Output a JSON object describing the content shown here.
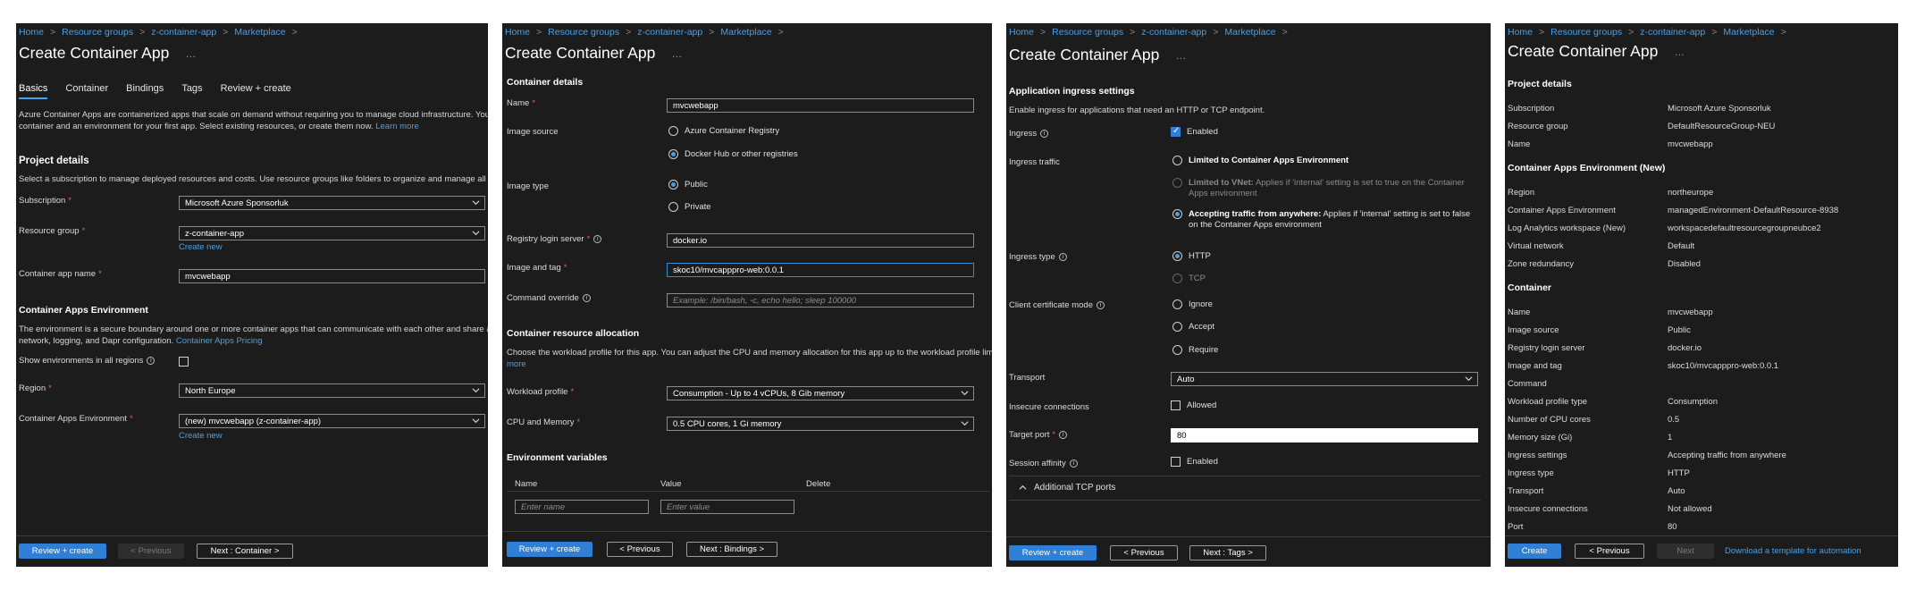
{
  "breadcrumb": [
    "Home",
    "Resource groups",
    "z-container-app",
    "Marketplace"
  ],
  "title": "Create Container App",
  "more": "…",
  "p1": {
    "tabs": [
      "Basics",
      "Container",
      "Bindings",
      "Tags",
      "Review + create"
    ],
    "intro_line1": "Azure Container Apps are containerized apps that scale on demand without requiring you to manage cloud infrastructure. You'll",
    "intro_line2": "container and an environment for your first app. Select existing resources, or create them now.",
    "learn_more": "Learn more",
    "project_details": "Project details",
    "project_desc": "Select a subscription to manage deployed resources and costs. Use resource groups like folders to organize and manage all your",
    "subscription_label": "Subscription",
    "subscription_value": "Microsoft Azure Sponsorluk",
    "rg_label": "Resource group",
    "rg_value": "z-container-app",
    "create_new": "Create new",
    "app_name_label": "Container app name",
    "app_name_value": "mvcwebapp",
    "env_section": "Container Apps Environment",
    "env_desc1": "The environment is a secure boundary around one or more container apps that can communicate with each other and share a vi",
    "env_desc2": "network, logging, and Dapr configuration.",
    "pricing_link": "Container Apps Pricing",
    "show_env_label": "Show environments in all regions",
    "region_label": "Region",
    "region_value": "North Europe",
    "cae_label": "Container Apps Environment",
    "cae_value": "(new) mvcwebapp (z-container-app)",
    "btn_review": "Review + create",
    "btn_prev": "< Previous",
    "btn_next": "Next : Container >"
  },
  "p2": {
    "container_details": "Container details",
    "name_label": "Name",
    "name_value": "mvcwebapp",
    "image_source_label": "Image source",
    "src_acr": "Azure Container Registry",
    "src_docker": "Docker Hub or other registries",
    "image_type_label": "Image type",
    "type_public": "Public",
    "type_private": "Private",
    "registry_label": "Registry login server",
    "registry_value": "docker.io",
    "image_tag_label": "Image and tag",
    "image_tag_value": "skoc10/mvcapppro-web:0.0.1",
    "cmd_label": "Command override",
    "cmd_placeholder": "Example: /bin/bash, -c, echo hello; sleep 100000",
    "alloc_section": "Container resource allocation",
    "alloc_desc": "Choose the workload profile for this app. You can adjust the CPU and memory allocation for this app up to the workload profile limit.",
    "alloc_more": "more",
    "workload_label": "Workload profile",
    "workload_value": "Consumption - Up to 4 vCPUs, 8 Gib memory",
    "cpu_label": "CPU and Memory",
    "cpu_value": "0.5 CPU cores, 1 Gi memory",
    "env_vars": "Environment variables",
    "col_name": "Name",
    "col_value": "Value",
    "col_delete": "Delete",
    "ph_name": "Enter name",
    "ph_value": "Enter value",
    "btn_review": "Review + create",
    "btn_prev": "< Previous",
    "btn_next": "Next : Bindings >"
  },
  "p3": {
    "ingress_section": "Application ingress settings",
    "ingress_desc": "Enable ingress for applications that need an HTTP or TCP endpoint.",
    "ingress_label": "Ingress",
    "ingress_enabled": "Enabled",
    "traffic_label": "Ingress traffic",
    "traffic_limited_env": "Limited to Container Apps Environment",
    "traffic_vnet_bold": "Limited to VNet:",
    "traffic_vnet_desc1": " Applies if 'internal' setting is set to true on the Container",
    "traffic_vnet_desc2": "Apps environment",
    "traffic_any_bold": "Accepting traffic from anywhere:",
    "traffic_any_desc1": " Applies if 'internal' setting is set to false",
    "traffic_any_desc2": "on the Container Apps environment",
    "type_label": "Ingress type",
    "type_http": "HTTP",
    "type_tcp": "TCP",
    "cert_label": "Client certificate mode",
    "cert_ignore": "Ignore",
    "cert_accept": "Accept",
    "cert_require": "Require",
    "transport_label": "Transport",
    "transport_value": "Auto",
    "insecure_label": "Insecure connections",
    "insecure_allowed": "Allowed",
    "port_label": "Target port",
    "port_value": "80",
    "affinity_label": "Session affinity",
    "affinity_enabled": "Enabled",
    "tcp_ports": "Additional TCP ports",
    "btn_review": "Review + create",
    "btn_prev": "< Previous",
    "btn_next": "Next : Tags >"
  },
  "p4": {
    "project_details": "Project details",
    "project_rows": [
      {
        "k": "Subscription",
        "v": "Microsoft Azure Sponsorluk"
      },
      {
        "k": "Resource group",
        "v": "DefaultResourceGroup-NEU"
      },
      {
        "k": "Name",
        "v": "mvcwebapp"
      }
    ],
    "env_section": "Container Apps Environment (New)",
    "env_rows": [
      {
        "k": "Region",
        "v": "northeurope"
      },
      {
        "k": "Container Apps Environment",
        "v": "managedEnvironment-DefaultResource-8938"
      },
      {
        "k": "Log Analytics workspace (New)",
        "v": "workspacedefaultresourcegroupneubce2"
      },
      {
        "k": "Virtual network",
        "v": "Default"
      },
      {
        "k": "Zone redundancy",
        "v": "Disabled"
      }
    ],
    "container_section": "Container",
    "container_rows": [
      {
        "k": "Name",
        "v": "mvcwebapp"
      },
      {
        "k": "Image source",
        "v": "Public"
      },
      {
        "k": "Registry login server",
        "v": "docker.io"
      },
      {
        "k": "Image and tag",
        "v": "skoc10/mvcapppro-web:0.0.1"
      },
      {
        "k": "Command",
        "v": ""
      },
      {
        "k": "Workload profile type",
        "v": "Consumption"
      },
      {
        "k": "Number of CPU cores",
        "v": "0.5"
      },
      {
        "k": "Memory size (Gi)",
        "v": "1"
      },
      {
        "k": "Ingress settings",
        "v": "Accepting traffic from anywhere"
      },
      {
        "k": "Ingress type",
        "v": "HTTP"
      },
      {
        "k": "Transport",
        "v": "Auto"
      },
      {
        "k": "Insecure connections",
        "v": "Not allowed"
      },
      {
        "k": "Port",
        "v": "80"
      }
    ],
    "btn_create": "Create",
    "btn_prev": "< Previous",
    "btn_next": "Next",
    "download_link": "Download a template for automation"
  }
}
